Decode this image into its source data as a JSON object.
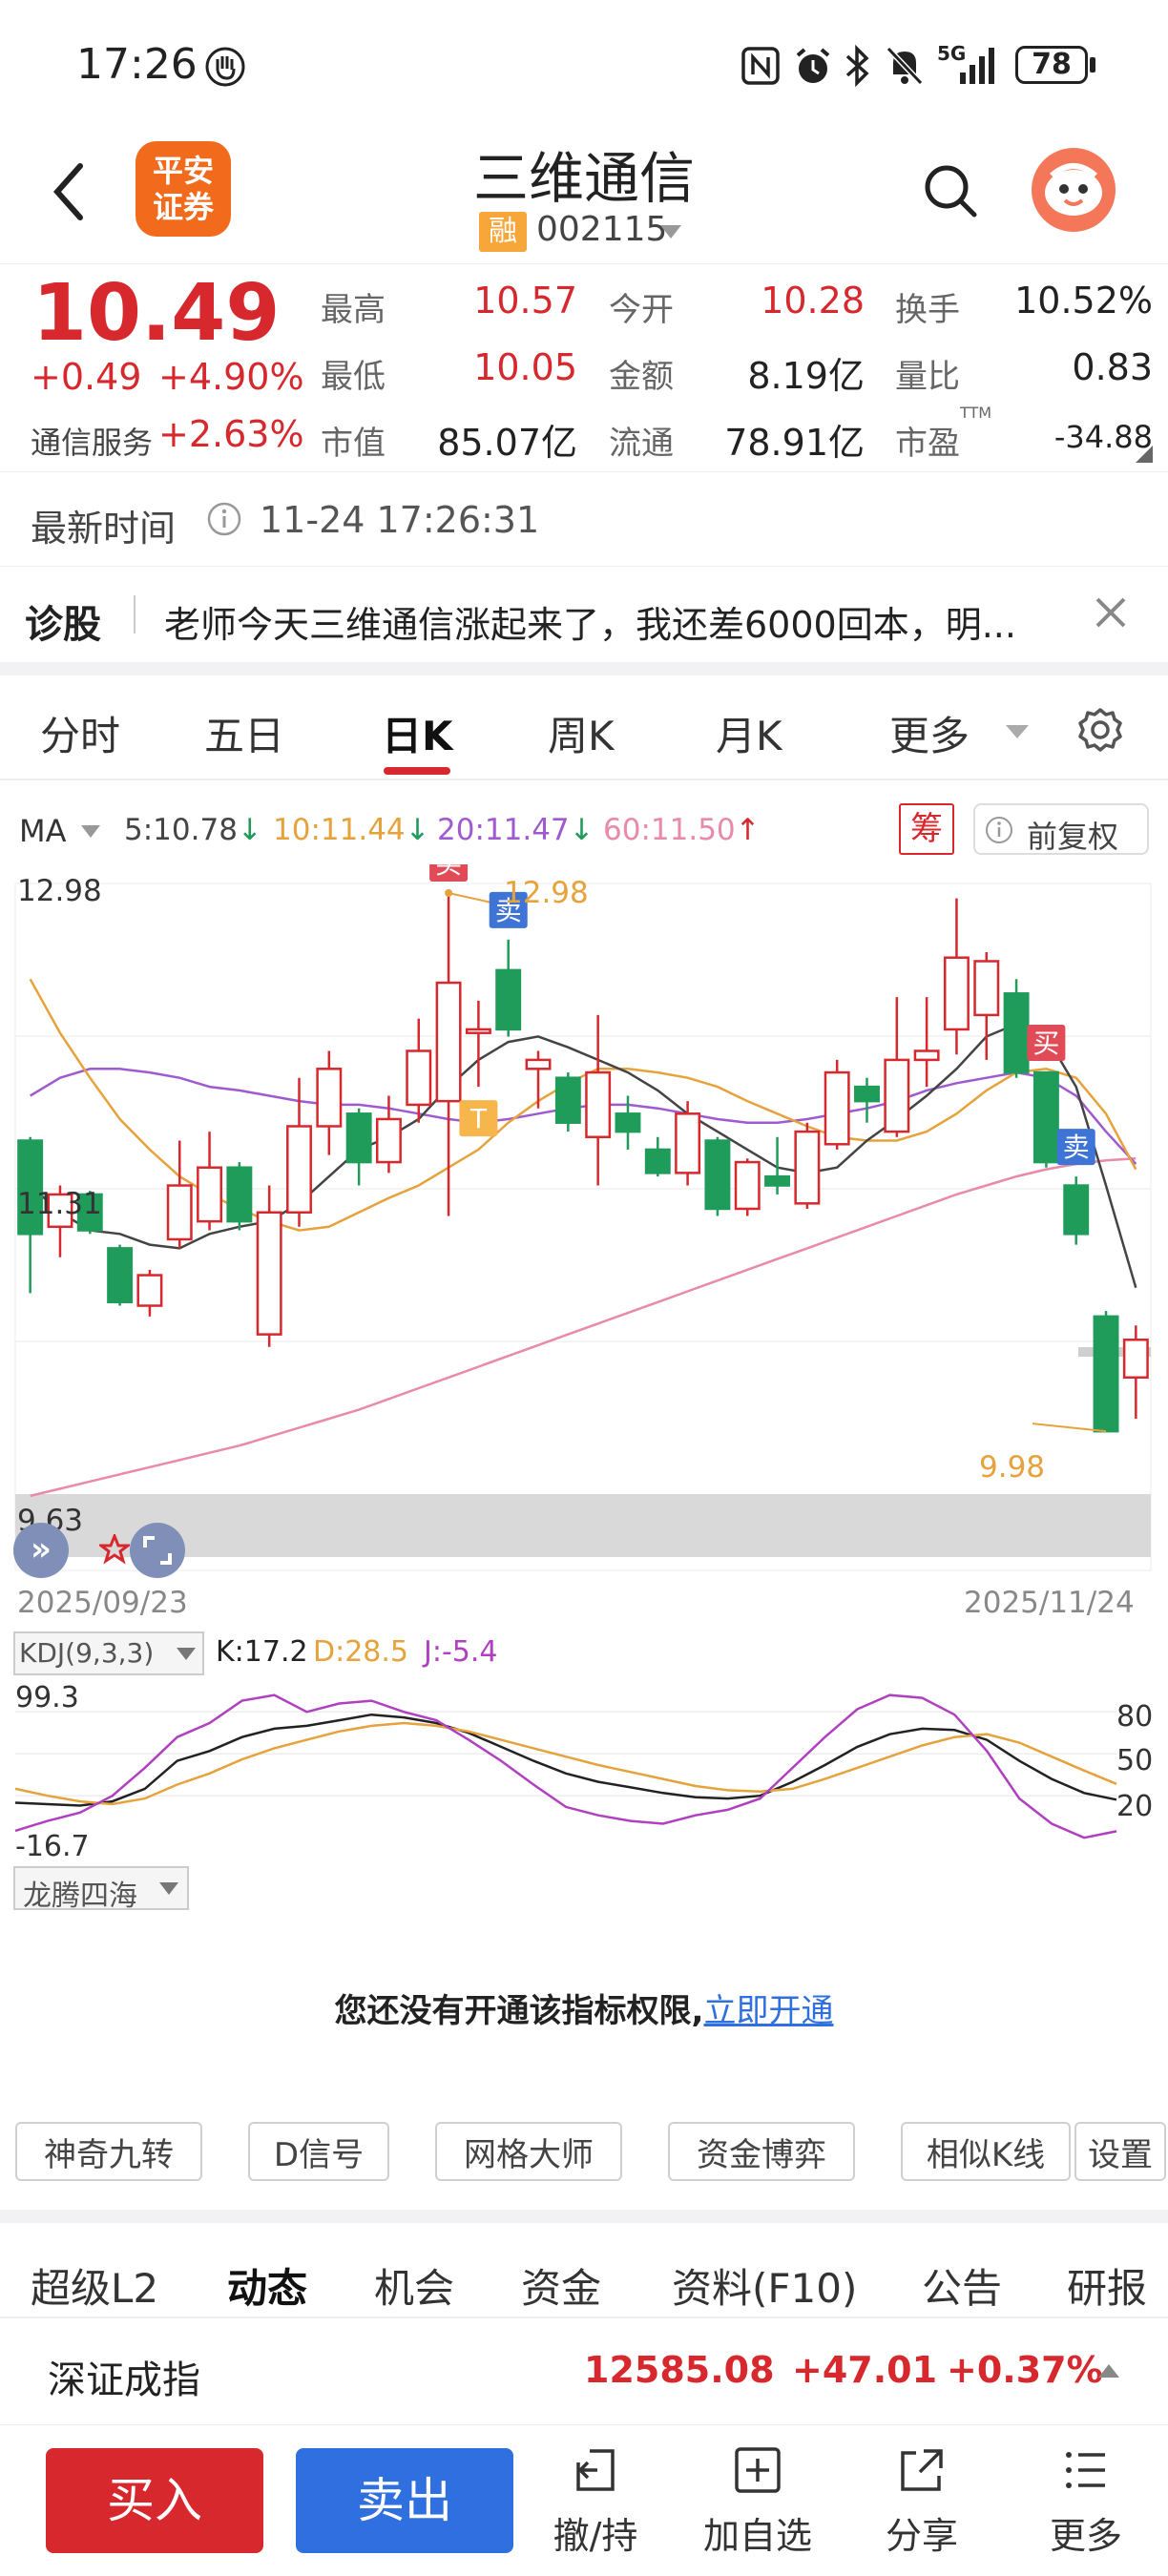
{
  "status_bar": {
    "time": "17:26",
    "battery": "78",
    "network": "5G"
  },
  "header": {
    "broker_logo_line1": "平安",
    "broker_logo_line2": "证券",
    "stock_name": "三维通信",
    "margin_badge": "融",
    "stock_code": "002115"
  },
  "quote": {
    "price": "10.49",
    "change": "+0.49",
    "change_pct": "+4.90%",
    "sector": "通信服务",
    "sector_pct": "+2.63%",
    "grid": [
      {
        "label": "最高",
        "value": "10.57",
        "color": "red"
      },
      {
        "label": "今开",
        "value": "10.28",
        "color": "red"
      },
      {
        "label": "换手",
        "value": "10.52%",
        "color": "dark"
      },
      {
        "label": "最低",
        "value": "10.05",
        "color": "red"
      },
      {
        "label": "金额",
        "value": "8.19亿",
        "color": "dark"
      },
      {
        "label": "量比",
        "value": "0.83",
        "color": "dark"
      },
      {
        "label": "市值",
        "value": "85.07亿",
        "color": "dark"
      },
      {
        "label": "流通",
        "value": "78.91亿",
        "color": "dark"
      },
      {
        "label": "市盈",
        "value": "-34.88",
        "color": "dark"
      }
    ],
    "pe_suffix": "TTM"
  },
  "update": {
    "label": "最新时间",
    "time": "11-24 17:26:31"
  },
  "diagnosis": {
    "label": "诊股",
    "text": "老师今天三维通信涨起来了，我还差6000回本，明..."
  },
  "period_tabs": [
    "分时",
    "五日",
    "日K",
    "周K",
    "月K",
    "更多"
  ],
  "active_period": "日K",
  "ma": {
    "label": "MA",
    "items": [
      {
        "text": "5:10.78",
        "arrow": "↓",
        "color": "#444444"
      },
      {
        "text": "10:11.44",
        "arrow": "↓",
        "color": "#e6a23c"
      },
      {
        "text": "20:11.47",
        "arrow": "↓",
        "color": "#a05ad0"
      },
      {
        "text": "60:11.50",
        "arrow": "↑",
        "color": "#e88aa8"
      }
    ],
    "chip_btn": "筹",
    "adjust_btn": "前复权"
  },
  "chart_data": [
    {
      "type": "candlestick",
      "y_max_label": "12.98",
      "y_mid_label": "11.31",
      "y_min_label": "9.63",
      "high_annotation": "12.98",
      "low_annotation": "9.98",
      "x_start": "2025/09/23",
      "x_end": "2025/11/24",
      "ylim": [
        9.63,
        12.98
      ],
      "candles": [
        {
          "o": 11.6,
          "c": 11.08,
          "h": 11.62,
          "l": 10.75
        },
        {
          "o": 11.12,
          "c": 11.3,
          "h": 11.35,
          "l": 10.95
        },
        {
          "o": 11.3,
          "c": 11.1,
          "h": 11.32,
          "l": 11.08
        },
        {
          "o": 11.0,
          "c": 10.7,
          "h": 11.02,
          "l": 10.68
        },
        {
          "o": 10.68,
          "c": 10.85,
          "h": 10.88,
          "l": 10.62
        },
        {
          "o": 11.05,
          "c": 11.35,
          "h": 11.6,
          "l": 11.0
        },
        {
          "o": 11.15,
          "c": 11.45,
          "h": 11.65,
          "l": 11.1
        },
        {
          "o": 11.45,
          "c": 11.15,
          "h": 11.48,
          "l": 11.1
        },
        {
          "o": 10.52,
          "c": 11.2,
          "h": 11.35,
          "l": 10.45
        },
        {
          "o": 11.2,
          "c": 11.68,
          "h": 11.95,
          "l": 11.12
        },
        {
          "o": 11.68,
          "c": 12.0,
          "h": 12.1,
          "l": 11.52
        },
        {
          "o": 11.75,
          "c": 11.48,
          "h": 11.78,
          "l": 11.35
        },
        {
          "o": 11.48,
          "c": 11.72,
          "h": 11.85,
          "l": 11.42
        },
        {
          "o": 11.8,
          "c": 12.1,
          "h": 12.28,
          "l": 11.7
        },
        {
          "o": 11.82,
          "c": 12.48,
          "h": 12.98,
          "l": 11.18
        },
        {
          "o": 12.2,
          "c": 12.22,
          "h": 12.38,
          "l": 11.9
        },
        {
          "o": 12.55,
          "c": 12.22,
          "h": 12.72,
          "l": 12.18
        },
        {
          "o": 12.0,
          "c": 12.05,
          "h": 12.1,
          "l": 11.78
        },
        {
          "o": 11.95,
          "c": 11.7,
          "h": 11.98,
          "l": 11.65
        },
        {
          "o": 11.62,
          "c": 11.98,
          "h": 12.3,
          "l": 11.35
        },
        {
          "o": 11.75,
          "c": 11.65,
          "h": 11.85,
          "l": 11.55
        },
        {
          "o": 11.55,
          "c": 11.42,
          "h": 11.62,
          "l": 11.4
        },
        {
          "o": 11.42,
          "c": 11.75,
          "h": 11.82,
          "l": 11.35
        },
        {
          "o": 11.6,
          "c": 11.22,
          "h": 11.62,
          "l": 11.18
        },
        {
          "o": 11.22,
          "c": 11.48,
          "h": 11.5,
          "l": 11.18
        },
        {
          "o": 11.4,
          "c": 11.35,
          "h": 11.62,
          "l": 11.3
        },
        {
          "o": 11.25,
          "c": 11.65,
          "h": 11.7,
          "l": 11.22
        },
        {
          "o": 11.58,
          "c": 11.98,
          "h": 12.05,
          "l": 11.55
        },
        {
          "o": 11.9,
          "c": 11.82,
          "h": 11.95,
          "l": 11.7
        },
        {
          "o": 11.65,
          "c": 12.05,
          "h": 12.4,
          "l": 11.62
        },
        {
          "o": 12.05,
          "c": 12.1,
          "h": 12.4,
          "l": 11.9
        },
        {
          "o": 12.22,
          "c": 12.62,
          "h": 12.95,
          "l": 12.08
        },
        {
          "o": 12.3,
          "c": 12.6,
          "h": 12.65,
          "l": 12.05
        },
        {
          "o": 12.42,
          "c": 11.98,
          "h": 12.5,
          "l": 11.95
        },
        {
          "o": 11.98,
          "c": 11.48,
          "h": 11.98,
          "l": 11.45
        },
        {
          "o": 11.35,
          "c": 11.08,
          "h": 11.4,
          "l": 11.02
        },
        {
          "o": 10.62,
          "c": 9.98,
          "h": 10.65,
          "l": 9.98
        },
        {
          "o": 10.28,
          "c": 10.49,
          "h": 10.57,
          "l": 10.05
        }
      ],
      "ma5": [
        11.35,
        11.2,
        11.1,
        11.08,
        11.02,
        11.0,
        11.08,
        11.12,
        11.15,
        11.25,
        11.4,
        11.55,
        11.62,
        11.72,
        11.9,
        12.05,
        12.15,
        12.18,
        12.12,
        12.05,
        11.98,
        11.88,
        11.75,
        11.65,
        11.55,
        11.45,
        11.42,
        11.45,
        11.6,
        11.72,
        11.85,
        12.0,
        12.18,
        12.25,
        12.18,
        11.9,
        11.35,
        10.78
      ],
      "ma10": [
        12.5,
        12.2,
        11.95,
        11.72,
        11.55,
        11.4,
        11.3,
        11.22,
        11.15,
        11.1,
        11.12,
        11.2,
        11.28,
        11.35,
        11.45,
        11.55,
        11.7,
        11.82,
        11.92,
        12.0,
        12.0,
        11.98,
        11.95,
        11.9,
        11.82,
        11.75,
        11.68,
        11.62,
        11.6,
        11.6,
        11.65,
        11.75,
        11.88,
        11.98,
        12.0,
        11.95,
        11.75,
        11.44
      ],
      "ma20": [
        11.85,
        11.95,
        12.0,
        12.0,
        11.98,
        11.95,
        11.9,
        11.88,
        11.85,
        11.82,
        11.8,
        11.8,
        11.78,
        11.75,
        11.72,
        11.7,
        11.72,
        11.75,
        11.78,
        11.8,
        11.8,
        11.78,
        11.75,
        11.72,
        11.7,
        11.7,
        11.72,
        11.75,
        11.78,
        11.82,
        11.88,
        11.92,
        11.95,
        11.98,
        11.95,
        11.85,
        11.65,
        11.47
      ],
      "ma60": [
        9.62,
        9.66,
        9.7,
        9.74,
        9.78,
        9.82,
        9.86,
        9.9,
        9.95,
        10.0,
        10.05,
        10.1,
        10.16,
        10.22,
        10.28,
        10.34,
        10.4,
        10.46,
        10.52,
        10.58,
        10.64,
        10.7,
        10.76,
        10.82,
        10.88,
        10.94,
        11.0,
        11.06,
        11.12,
        11.18,
        11.24,
        11.3,
        11.35,
        11.4,
        11.44,
        11.47,
        11.49,
        11.5
      ],
      "markers": [
        {
          "label": "买",
          "index": 14,
          "kind": "buy"
        },
        {
          "label": "卖",
          "index": 16,
          "kind": "sell"
        },
        {
          "label": "T",
          "index": 15,
          "kind": "t"
        },
        {
          "label": "买",
          "index": 34,
          "kind": "buy"
        },
        {
          "label": "卖",
          "index": 35,
          "kind": "sell"
        }
      ]
    },
    {
      "type": "line",
      "indicator": "KDJ(9,3,3)",
      "k_label": "K:17.2",
      "d_label": "D:28.5",
      "j_label": "J:-5.4",
      "y_max_label": "99.3",
      "y_min_label": "-16.7",
      "right_ticks": [
        "80",
        "50",
        "20"
      ],
      "ylim": [
        -16.7,
        99.3
      ],
      "series": [
        {
          "key": "K",
          "color": "#222222",
          "values": [
            15,
            14,
            13,
            16,
            25,
            45,
            52,
            62,
            68,
            70,
            74,
            78,
            76,
            72,
            65,
            55,
            45,
            36,
            30,
            26,
            22,
            19,
            18,
            20,
            30,
            42,
            55,
            64,
            68,
            67,
            60,
            45,
            32,
            22,
            17.2
          ]
        },
        {
          "key": "D",
          "color": "#e6a23c",
          "values": [
            25,
            20,
            16,
            14,
            18,
            28,
            36,
            46,
            54,
            60,
            66,
            70,
            72,
            70,
            66,
            60,
            54,
            48,
            42,
            37,
            32,
            27,
            24,
            23,
            25,
            32,
            40,
            48,
            56,
            62,
            64,
            58,
            48,
            38,
            28.5
          ]
        },
        {
          "key": "J",
          "color": "#b040c0",
          "values": [
            -5,
            2,
            8,
            20,
            40,
            62,
            72,
            88,
            92,
            80,
            86,
            88,
            80,
            74,
            60,
            45,
            28,
            12,
            6,
            2,
            0,
            6,
            10,
            18,
            40,
            62,
            82,
            92,
            90,
            78,
            52,
            18,
            0,
            -10,
            -5.4
          ]
        }
      ]
    }
  ],
  "extra_indicator": {
    "name": "龙腾四海",
    "notice": "您还没有开通该指标权限,",
    "link": "立即开通"
  },
  "tool_buttons": [
    "神奇九转",
    "D信号",
    "网格大师",
    "资金博弈",
    "相似K线",
    "设置"
  ],
  "bottom_tabs": [
    "超级L2",
    "动态",
    "机会",
    "资金",
    "资料(F10)",
    "公告",
    "研报"
  ],
  "active_bottom_tab": "动态",
  "index_bar": {
    "name": "深证成指",
    "value": "12585.08",
    "change": "+47.01",
    "pct": "+0.37%"
  },
  "nav": {
    "buy": "买入",
    "sell": "卖出",
    "items": [
      "撤/持",
      "加自选",
      "分享",
      "更多"
    ]
  },
  "colors": {
    "up": "#d7282e",
    "down": "#1f9b5a",
    "buy_button": "#d7282e",
    "sell_button": "#2f6fe0",
    "link": "#2f6fe0"
  }
}
